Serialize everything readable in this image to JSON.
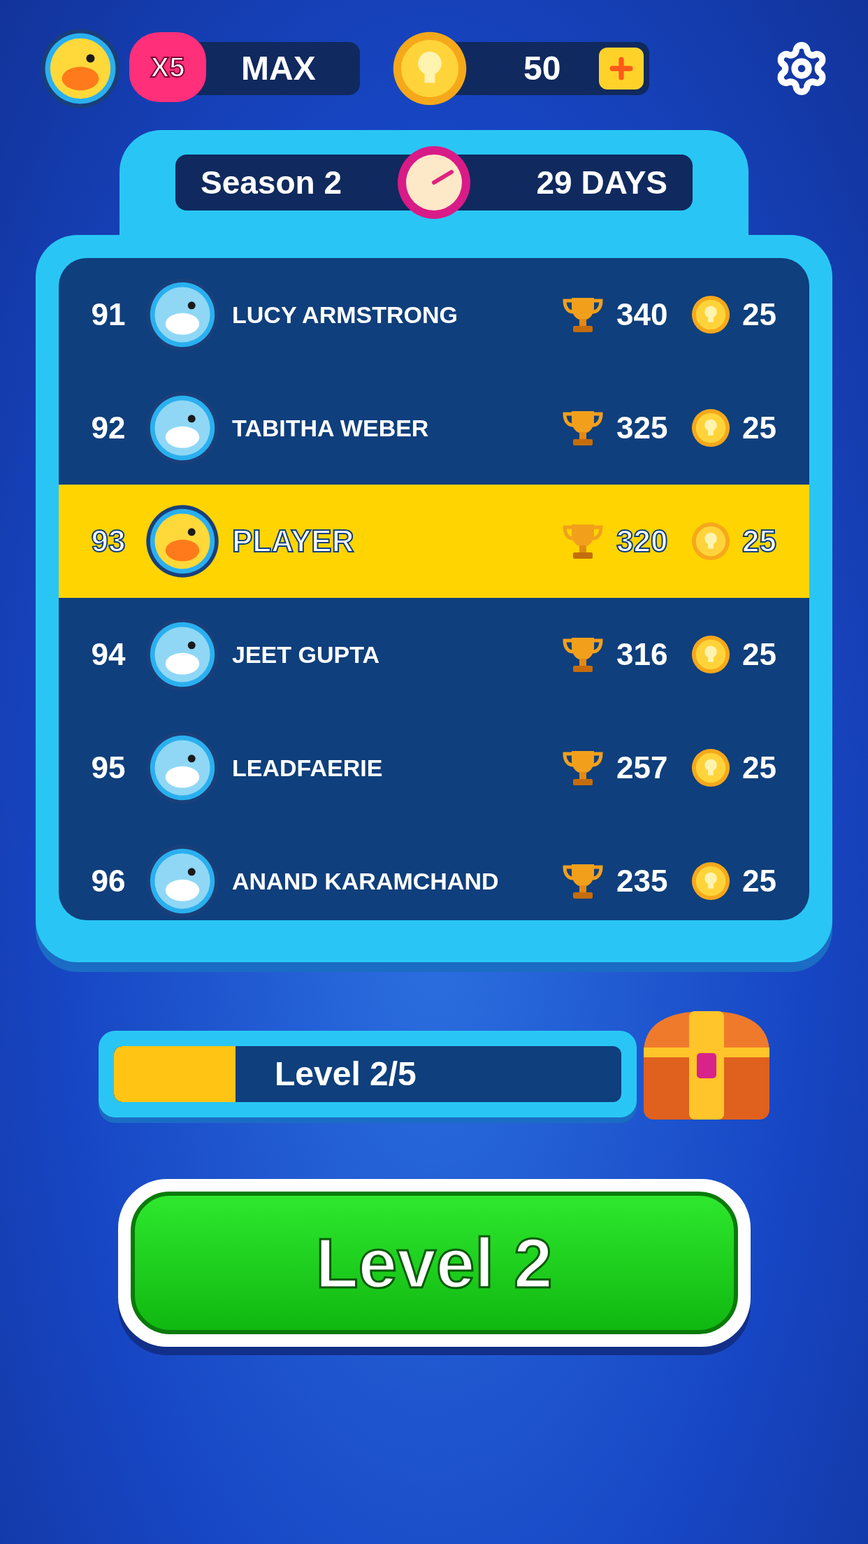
{
  "top_bar": {
    "lives_badge": "X5",
    "lives_value": "MAX",
    "coins": "50"
  },
  "season": {
    "title": "Season 2",
    "remaining": "29 DAYS"
  },
  "leaderboard": [
    {
      "rank": "91",
      "name": "LUCY ARMSTRONG",
      "trophies": "340",
      "coins": "25",
      "selected": false
    },
    {
      "rank": "92",
      "name": "TABITHA WEBER",
      "trophies": "325",
      "coins": "25",
      "selected": false
    },
    {
      "rank": "93",
      "name": "PLAYER",
      "trophies": "320",
      "coins": "25",
      "selected": true
    },
    {
      "rank": "94",
      "name": "JEET GUPTA",
      "trophies": "316",
      "coins": "25",
      "selected": false
    },
    {
      "rank": "95",
      "name": "LEADFAERIE",
      "trophies": "257",
      "coins": "25",
      "selected": false
    },
    {
      "rank": "96",
      "name": "ANAND KARAMCHAND",
      "trophies": "235",
      "coins": "25",
      "selected": false
    }
  ],
  "progress": {
    "label": "Level 2/5",
    "level": 0.24
  },
  "play_button": "Level 2"
}
